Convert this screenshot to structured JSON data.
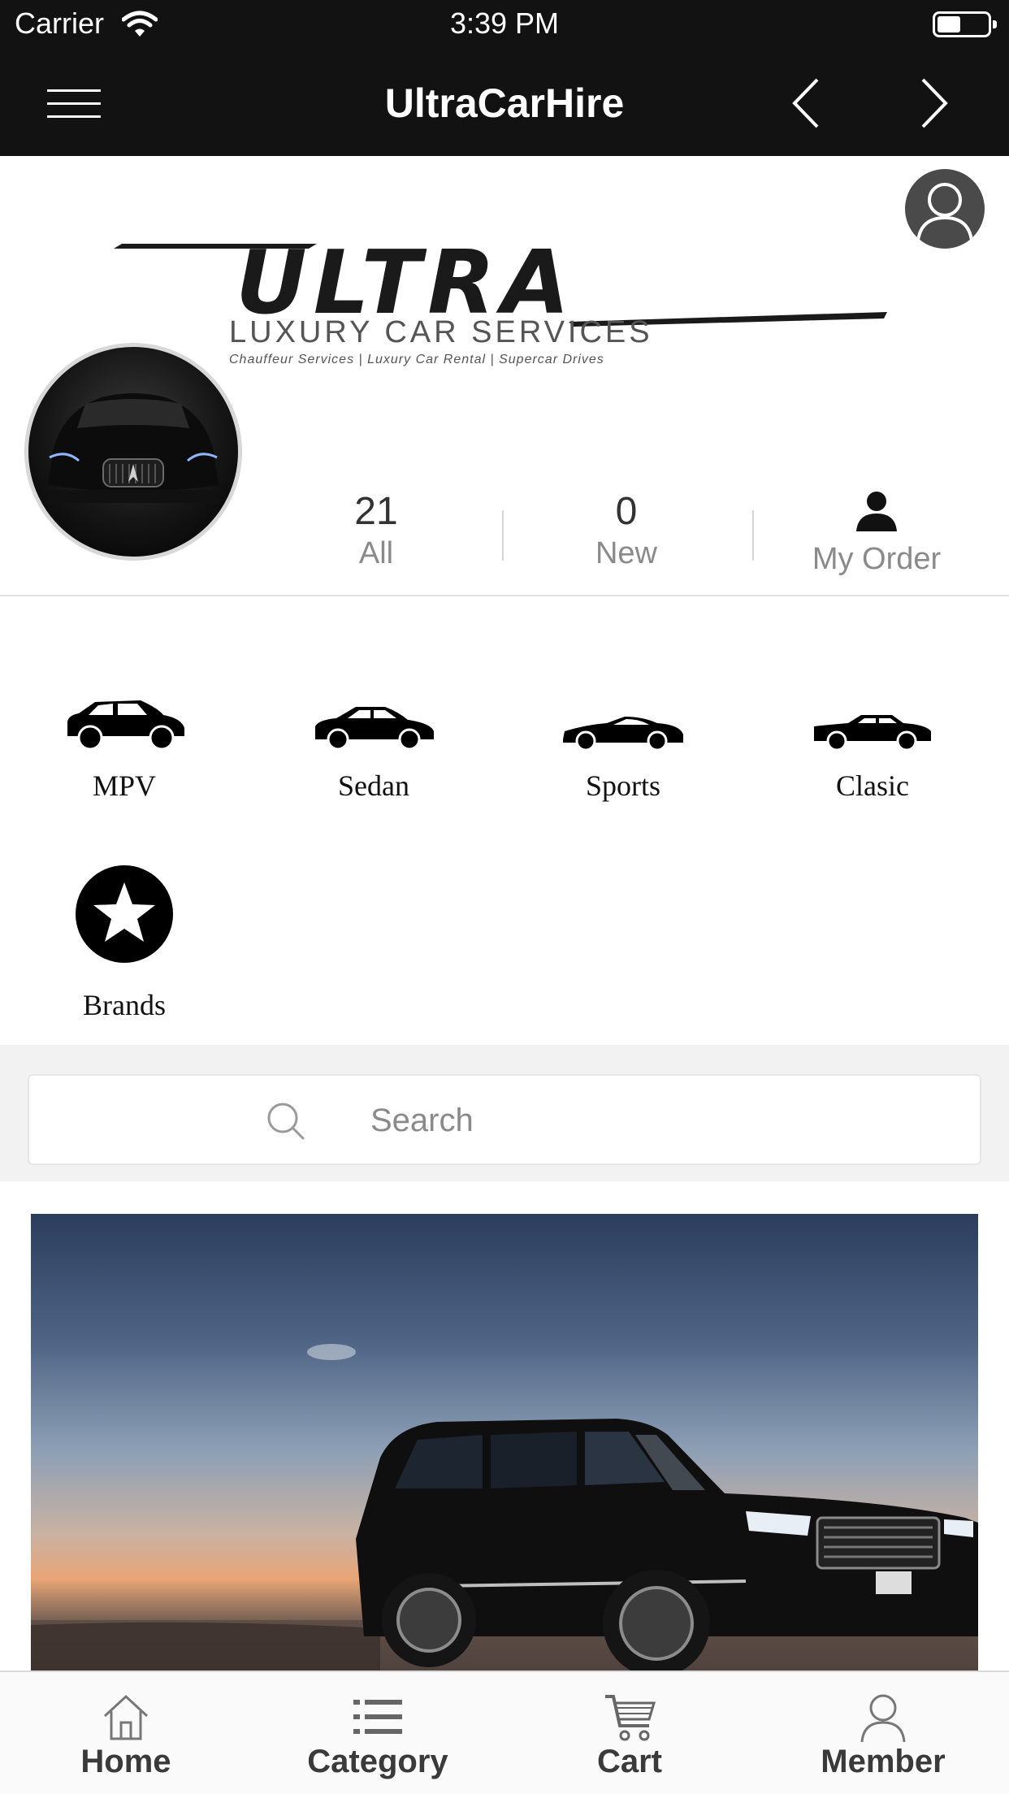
{
  "status_bar": {
    "carrier": "Carrier",
    "time": "3:39 PM"
  },
  "nav": {
    "title": "UltraCarHire",
    "menu_icon": "hamburger-menu-icon",
    "back_icon": "chevron-left-icon",
    "forward_icon": "chevron-right-icon"
  },
  "header": {
    "logo": {
      "brand": "ULTRA",
      "subtitle": "LUXURY CAR SERVICES",
      "tagline": "Chauffeur Services | Luxury Car Rental | Supercar Drives"
    },
    "stats": [
      {
        "value": "21",
        "label": "All"
      },
      {
        "value": "0",
        "label": "New"
      },
      {
        "label": "My Order",
        "icon": "person-icon"
      }
    ]
  },
  "categories": [
    {
      "label": "MPV",
      "icon": "suv-icon"
    },
    {
      "label": "Sedan",
      "icon": "sedan-icon"
    },
    {
      "label": "Sports",
      "icon": "sports-car-icon"
    },
    {
      "label": "Clasic",
      "icon": "classic-car-icon"
    },
    {
      "label": "Brands",
      "icon": "star-icon"
    }
  ],
  "search": {
    "placeholder": "Search",
    "value": ""
  },
  "tab_bar": {
    "tabs": [
      {
        "label": "Home",
        "icon": "home-icon"
      },
      {
        "label": "Category",
        "icon": "list-icon"
      },
      {
        "label": "Cart",
        "icon": "cart-icon"
      },
      {
        "label": "Member",
        "icon": "member-icon"
      }
    ]
  },
  "colors": {
    "bar_background": "#121212",
    "tab_bar_background": "#fafafa",
    "search_band": "#f2f2f2"
  }
}
